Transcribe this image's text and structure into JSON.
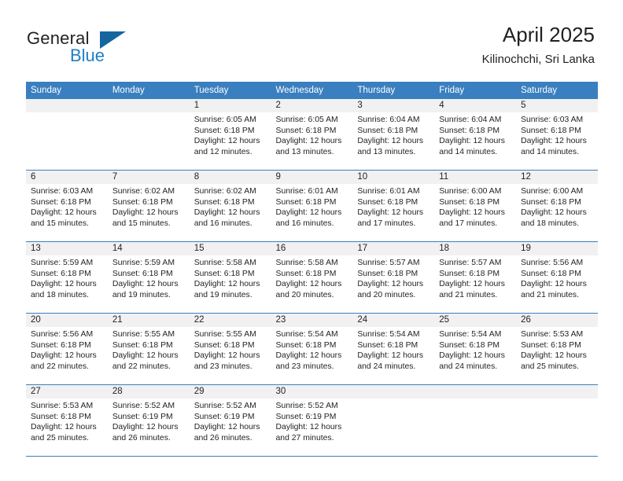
{
  "brand": {
    "name_top": "General",
    "name_bottom": "Blue",
    "triangle_color": "#15659f",
    "blue_color": "#1f7fc4"
  },
  "header": {
    "title": "April 2025",
    "subtitle": "Kilinochchi, Sri Lanka"
  },
  "theme": {
    "header_blue": "#3a7fbf",
    "band_gray": "#f1f1f1",
    "text": "#231f20"
  },
  "weekday_headers": [
    "Sunday",
    "Monday",
    "Tuesday",
    "Wednesday",
    "Thursday",
    "Friday",
    "Saturday"
  ],
  "calendar": {
    "month": "April",
    "year": "2025",
    "location": "Kilinochchi, Sri Lanka",
    "weeks": [
      [
        {
          "day": "",
          "sunrise": "",
          "sunset": "",
          "daylight_a": "",
          "daylight_b": ""
        },
        {
          "day": "",
          "sunrise": "",
          "sunset": "",
          "daylight_a": "",
          "daylight_b": ""
        },
        {
          "day": "1",
          "sunrise": "Sunrise: 6:05 AM",
          "sunset": "Sunset: 6:18 PM",
          "daylight_a": "Daylight: 12 hours",
          "daylight_b": "and 12 minutes."
        },
        {
          "day": "2",
          "sunrise": "Sunrise: 6:05 AM",
          "sunset": "Sunset: 6:18 PM",
          "daylight_a": "Daylight: 12 hours",
          "daylight_b": "and 13 minutes."
        },
        {
          "day": "3",
          "sunrise": "Sunrise: 6:04 AM",
          "sunset": "Sunset: 6:18 PM",
          "daylight_a": "Daylight: 12 hours",
          "daylight_b": "and 13 minutes."
        },
        {
          "day": "4",
          "sunrise": "Sunrise: 6:04 AM",
          "sunset": "Sunset: 6:18 PM",
          "daylight_a": "Daylight: 12 hours",
          "daylight_b": "and 14 minutes."
        },
        {
          "day": "5",
          "sunrise": "Sunrise: 6:03 AM",
          "sunset": "Sunset: 6:18 PM",
          "daylight_a": "Daylight: 12 hours",
          "daylight_b": "and 14 minutes."
        }
      ],
      [
        {
          "day": "6",
          "sunrise": "Sunrise: 6:03 AM",
          "sunset": "Sunset: 6:18 PM",
          "daylight_a": "Daylight: 12 hours",
          "daylight_b": "and 15 minutes."
        },
        {
          "day": "7",
          "sunrise": "Sunrise: 6:02 AM",
          "sunset": "Sunset: 6:18 PM",
          "daylight_a": "Daylight: 12 hours",
          "daylight_b": "and 15 minutes."
        },
        {
          "day": "8",
          "sunrise": "Sunrise: 6:02 AM",
          "sunset": "Sunset: 6:18 PM",
          "daylight_a": "Daylight: 12 hours",
          "daylight_b": "and 16 minutes."
        },
        {
          "day": "9",
          "sunrise": "Sunrise: 6:01 AM",
          "sunset": "Sunset: 6:18 PM",
          "daylight_a": "Daylight: 12 hours",
          "daylight_b": "and 16 minutes."
        },
        {
          "day": "10",
          "sunrise": "Sunrise: 6:01 AM",
          "sunset": "Sunset: 6:18 PM",
          "daylight_a": "Daylight: 12 hours",
          "daylight_b": "and 17 minutes."
        },
        {
          "day": "11",
          "sunrise": "Sunrise: 6:00 AM",
          "sunset": "Sunset: 6:18 PM",
          "daylight_a": "Daylight: 12 hours",
          "daylight_b": "and 17 minutes."
        },
        {
          "day": "12",
          "sunrise": "Sunrise: 6:00 AM",
          "sunset": "Sunset: 6:18 PM",
          "daylight_a": "Daylight: 12 hours",
          "daylight_b": "and 18 minutes."
        }
      ],
      [
        {
          "day": "13",
          "sunrise": "Sunrise: 5:59 AM",
          "sunset": "Sunset: 6:18 PM",
          "daylight_a": "Daylight: 12 hours",
          "daylight_b": "and 18 minutes."
        },
        {
          "day": "14",
          "sunrise": "Sunrise: 5:59 AM",
          "sunset": "Sunset: 6:18 PM",
          "daylight_a": "Daylight: 12 hours",
          "daylight_b": "and 19 minutes."
        },
        {
          "day": "15",
          "sunrise": "Sunrise: 5:58 AM",
          "sunset": "Sunset: 6:18 PM",
          "daylight_a": "Daylight: 12 hours",
          "daylight_b": "and 19 minutes."
        },
        {
          "day": "16",
          "sunrise": "Sunrise: 5:58 AM",
          "sunset": "Sunset: 6:18 PM",
          "daylight_a": "Daylight: 12 hours",
          "daylight_b": "and 20 minutes."
        },
        {
          "day": "17",
          "sunrise": "Sunrise: 5:57 AM",
          "sunset": "Sunset: 6:18 PM",
          "daylight_a": "Daylight: 12 hours",
          "daylight_b": "and 20 minutes."
        },
        {
          "day": "18",
          "sunrise": "Sunrise: 5:57 AM",
          "sunset": "Sunset: 6:18 PM",
          "daylight_a": "Daylight: 12 hours",
          "daylight_b": "and 21 minutes."
        },
        {
          "day": "19",
          "sunrise": "Sunrise: 5:56 AM",
          "sunset": "Sunset: 6:18 PM",
          "daylight_a": "Daylight: 12 hours",
          "daylight_b": "and 21 minutes."
        }
      ],
      [
        {
          "day": "20",
          "sunrise": "Sunrise: 5:56 AM",
          "sunset": "Sunset: 6:18 PM",
          "daylight_a": "Daylight: 12 hours",
          "daylight_b": "and 22 minutes."
        },
        {
          "day": "21",
          "sunrise": "Sunrise: 5:55 AM",
          "sunset": "Sunset: 6:18 PM",
          "daylight_a": "Daylight: 12 hours",
          "daylight_b": "and 22 minutes."
        },
        {
          "day": "22",
          "sunrise": "Sunrise: 5:55 AM",
          "sunset": "Sunset: 6:18 PM",
          "daylight_a": "Daylight: 12 hours",
          "daylight_b": "and 23 minutes."
        },
        {
          "day": "23",
          "sunrise": "Sunrise: 5:54 AM",
          "sunset": "Sunset: 6:18 PM",
          "daylight_a": "Daylight: 12 hours",
          "daylight_b": "and 23 minutes."
        },
        {
          "day": "24",
          "sunrise": "Sunrise: 5:54 AM",
          "sunset": "Sunset: 6:18 PM",
          "daylight_a": "Daylight: 12 hours",
          "daylight_b": "and 24 minutes."
        },
        {
          "day": "25",
          "sunrise": "Sunrise: 5:54 AM",
          "sunset": "Sunset: 6:18 PM",
          "daylight_a": "Daylight: 12 hours",
          "daylight_b": "and 24 minutes."
        },
        {
          "day": "26",
          "sunrise": "Sunrise: 5:53 AM",
          "sunset": "Sunset: 6:18 PM",
          "daylight_a": "Daylight: 12 hours",
          "daylight_b": "and 25 minutes."
        }
      ],
      [
        {
          "day": "27",
          "sunrise": "Sunrise: 5:53 AM",
          "sunset": "Sunset: 6:18 PM",
          "daylight_a": "Daylight: 12 hours",
          "daylight_b": "and 25 minutes."
        },
        {
          "day": "28",
          "sunrise": "Sunrise: 5:52 AM",
          "sunset": "Sunset: 6:19 PM",
          "daylight_a": "Daylight: 12 hours",
          "daylight_b": "and 26 minutes."
        },
        {
          "day": "29",
          "sunrise": "Sunrise: 5:52 AM",
          "sunset": "Sunset: 6:19 PM",
          "daylight_a": "Daylight: 12 hours",
          "daylight_b": "and 26 minutes."
        },
        {
          "day": "30",
          "sunrise": "Sunrise: 5:52 AM",
          "sunset": "Sunset: 6:19 PM",
          "daylight_a": "Daylight: 12 hours",
          "daylight_b": "and 27 minutes."
        },
        {
          "day": "",
          "sunrise": "",
          "sunset": "",
          "daylight_a": "",
          "daylight_b": ""
        },
        {
          "day": "",
          "sunrise": "",
          "sunset": "",
          "daylight_a": "",
          "daylight_b": ""
        },
        {
          "day": "",
          "sunrise": "",
          "sunset": "",
          "daylight_a": "",
          "daylight_b": ""
        }
      ]
    ]
  }
}
